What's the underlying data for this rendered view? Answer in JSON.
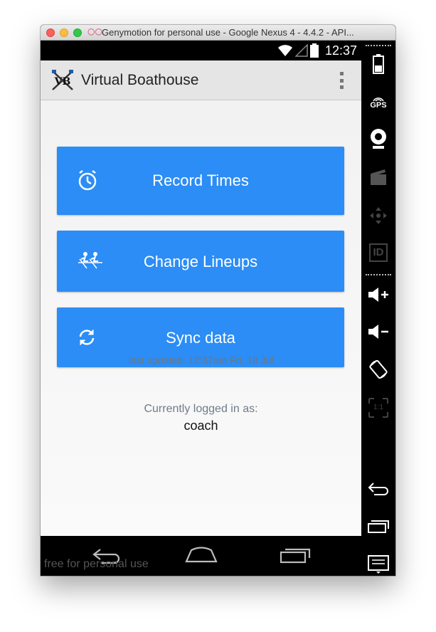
{
  "window": {
    "title": "Genymotion for personal use - Google Nexus 4 - 4.4.2 - API..."
  },
  "status_bar": {
    "time": "12:37",
    "icons": [
      "wifi-icon",
      "signal-icon",
      "battery-icon"
    ]
  },
  "action_bar": {
    "app_name": "Virtual Boathouse",
    "logo_text": "VB",
    "overflow_icon": "overflow-menu-icon"
  },
  "main": {
    "buttons": [
      {
        "label": "Record Times",
        "icon": "stopwatch-icon"
      },
      {
        "label": "Change Lineups",
        "icon": "rowers-icon"
      },
      {
        "label": "Sync data",
        "icon": "sync-icon"
      }
    ],
    "last_updated": "last updated: 12:37am Fri, 18 Jul",
    "logged_in_label": "Currently logged in as:",
    "logged_in_user": "coach"
  },
  "nav_bar": {
    "buttons": [
      "back-icon",
      "home-icon",
      "recents-icon"
    ],
    "watermark": "free for personal use"
  },
  "side_toolbar": {
    "gps_label": "GPS",
    "id_label": "ID",
    "scale_label": "1:1",
    "icons": [
      "battery-icon",
      "gps-icon",
      "webcam-icon",
      "clapper-icon",
      "dpad-icon",
      "id-icon",
      "volume-up-icon",
      "volume-down-icon",
      "rotate-icon",
      "scale-icon",
      "back-icon",
      "recents-icon",
      "menu-icon"
    ]
  },
  "colors": {
    "button_blue": "#2b8df5",
    "action_bar": "#e5e5e5",
    "background": "#f2f2f2"
  }
}
